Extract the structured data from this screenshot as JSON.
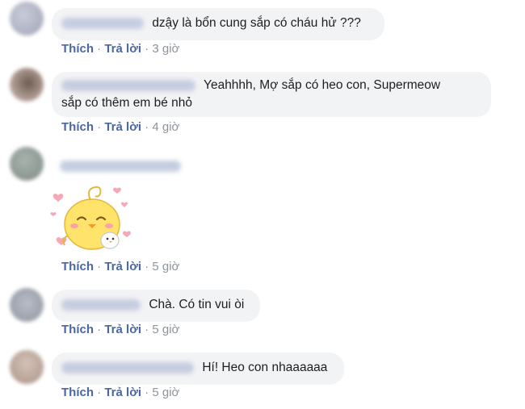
{
  "actions": {
    "like": "Thích",
    "reply": "Trả lời",
    "dot": "·"
  },
  "comments": [
    {
      "text": "dzậy là bổn cung sắp có cháu hử ???",
      "time": "3 giờ"
    },
    {
      "text_line1": "Yeahhhh, Mợ sắp có heo con, Supermeow",
      "text_line2": "sắp có thêm em bé nhỏ",
      "time": "4 giờ"
    },
    {
      "sticker": "yellow-chick-sticker",
      "time": "5 giờ"
    },
    {
      "text": "Chà. Có tin vui òi",
      "time": "5 giờ"
    },
    {
      "text": "Hí! Heo con nhaaaaaa",
      "time": "5 giờ"
    }
  ],
  "colors": {
    "bubble": "#f2f3f5",
    "link": "#4b67a1",
    "meta": "#8d949e",
    "text": "#1c1e21"
  }
}
